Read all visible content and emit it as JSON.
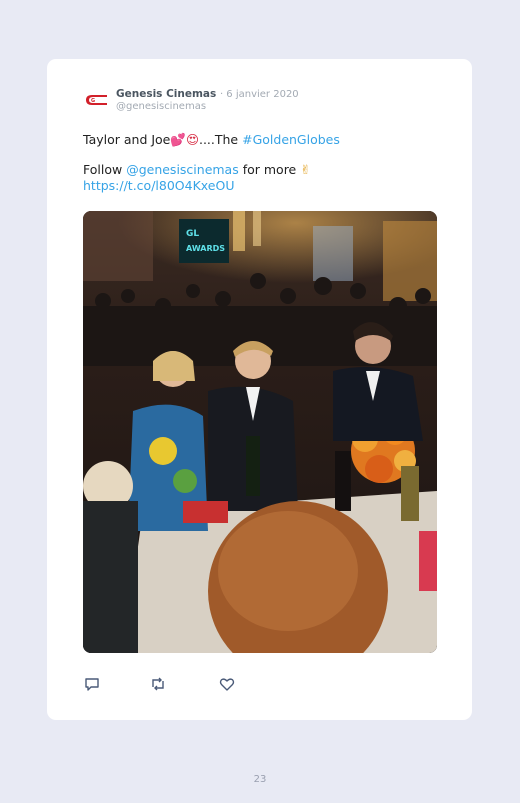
{
  "tweet": {
    "author_name": "Genesis Cinemas",
    "date": "· 6 janvier 2020",
    "handle": "@genesiscinemas",
    "text_prefix": "Taylor and Joe",
    "text_emojis": "💕😍",
    "text_ellipsis": "....The ",
    "hashtag": "#GoldenGlobes",
    "follow_prefix": "Follow ",
    "mention": "@genesiscinemas",
    "follow_suffix": " for more ",
    "follow_emoji": "✌",
    "short_link": "https://t.co/l80O4KxeOU"
  },
  "photo": {
    "description_icon": "photo-image",
    "sign_text": "GLOBE AWARDS"
  },
  "actions": {
    "reply_icon": "reply-icon",
    "retweet_icon": "retweet-icon",
    "like_icon": "heart-icon"
  },
  "footer": {
    "page_number": "23"
  },
  "colors": {
    "link": "#36a3e6",
    "background": "#e8eaf4",
    "card": "#ffffff"
  }
}
